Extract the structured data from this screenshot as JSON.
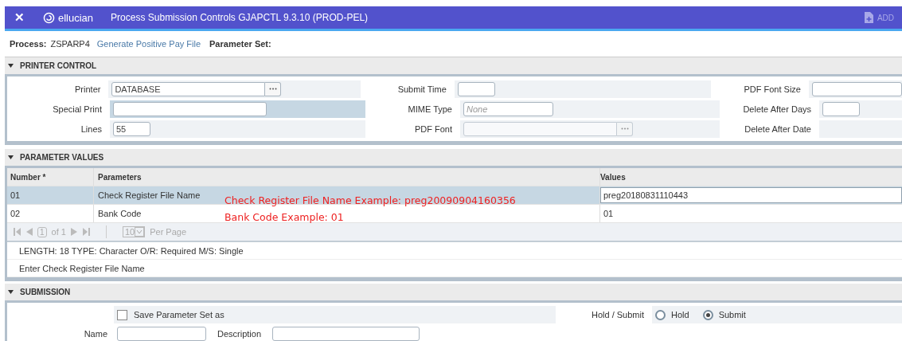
{
  "header": {
    "close": "✕",
    "brand": "ellucian",
    "title": "Process Submission Controls GJAPCTL 9.3.10 (PROD-PEL)",
    "add": "ADD"
  },
  "process": {
    "label": "Process:",
    "code": "ZSPARP4",
    "name": "Generate Positive Pay File",
    "set_label": "Parameter Set:"
  },
  "printer_control": {
    "title": "PRINTER CONTROL",
    "expanded": true,
    "rows": [
      [
        {
          "label": "Printer",
          "value": "DATABASE",
          "lookup": true,
          "kind": "long",
          "highlight": false
        },
        {
          "label": "Submit Time",
          "kind": "short",
          "highlight": false
        },
        {
          "label": "PDF Font Size",
          "kind": "medium"
        }
      ],
      [
        {
          "label": "Special Print",
          "kind": "long",
          "highlight": true
        },
        {
          "label": "MIME Type",
          "placeholder": "None",
          "kind": "medium",
          "highlight": false
        },
        {
          "label": "Delete After Days",
          "kind": "short"
        }
      ],
      [
        {
          "label": "Lines",
          "value": "55",
          "kind": "short",
          "highlight": false
        },
        {
          "label": "PDF Font",
          "lookup": true,
          "disabled": true,
          "kind": "long",
          "highlight": false
        },
        {
          "label": "Delete After Date"
        }
      ]
    ]
  },
  "parameter_values": {
    "title": "PARAMETER VALUES",
    "expanded": true,
    "columns": [
      "Number *",
      "Parameters",
      "Values"
    ],
    "rows": [
      {
        "number": "01",
        "parameter": "Check Register File Name",
        "value": "preg20180831110443",
        "selected": true
      },
      {
        "number": "02",
        "parameter": "Bank Code",
        "value": "01",
        "selected": false
      }
    ],
    "annotations": [
      "Check Register File Name  Example: preg20090904160356",
      "Bank Code  Example: 01"
    ],
    "pager": {
      "page": "1",
      "of": "of 1",
      "per_page": "10",
      "per_page_label": "Per Page"
    },
    "info": [
      "LENGTH: 18 TYPE: Character O/R: Required M/S: Single",
      "Enter Check Register File Name"
    ]
  },
  "submission": {
    "title": "SUBMISSION",
    "expanded": true,
    "save_set": {
      "label": "Save Parameter Set as",
      "checked": false
    },
    "name_label": "Name",
    "description_label": "Description",
    "hold_label": "Hold / Submit",
    "options": [
      {
        "label": "Hold",
        "selected": false
      },
      {
        "label": "Submit",
        "selected": true
      }
    ]
  }
}
